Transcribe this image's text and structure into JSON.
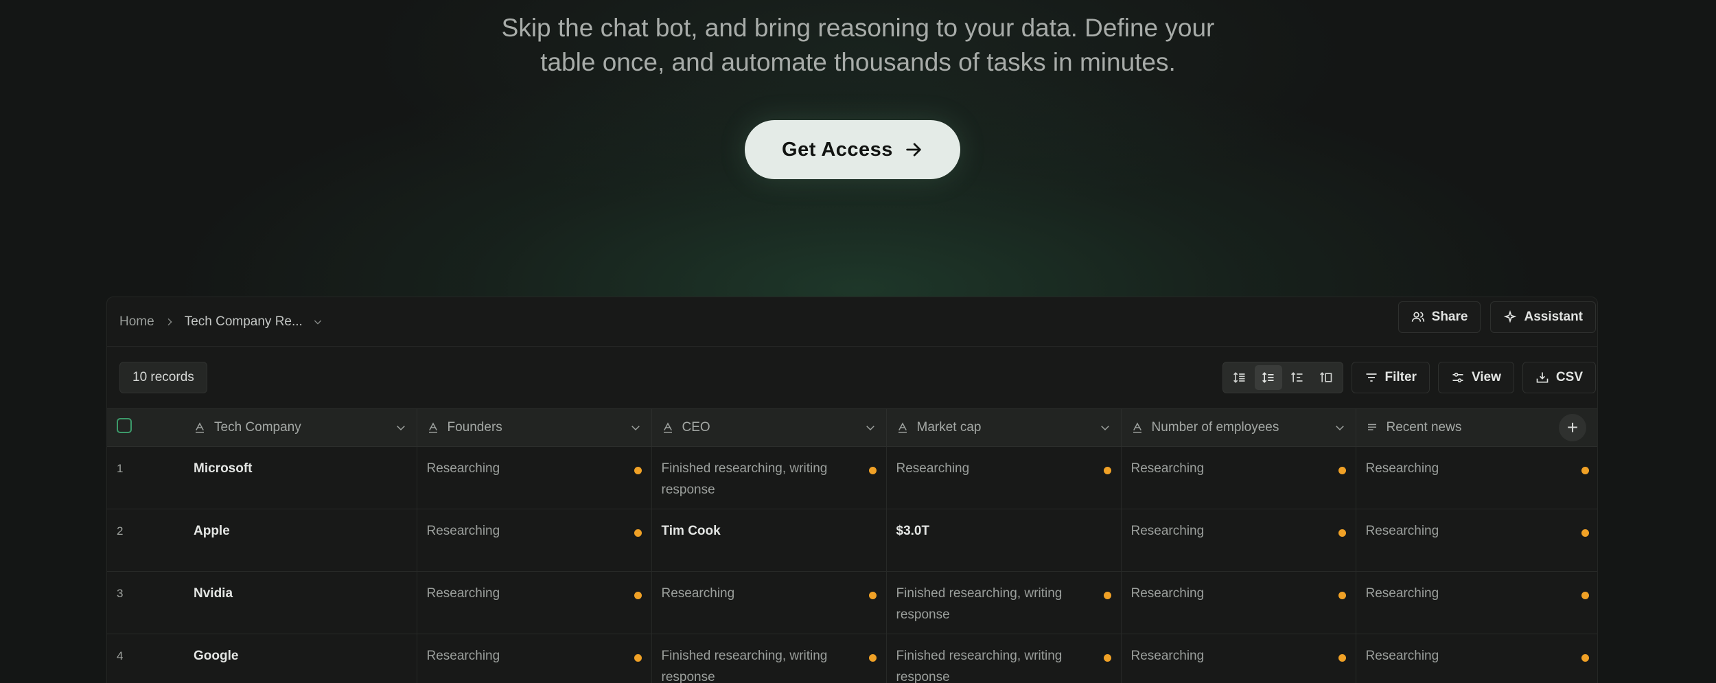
{
  "hero": {
    "line1": "Skip the chat bot, and bring reasoning to your data. Define your",
    "line2": "table once, and automate thousands of tasks in minutes.",
    "cta_label": "Get Access"
  },
  "breadcrumb": {
    "home": "Home",
    "current": "Tech Company Re..."
  },
  "top_actions": {
    "share": "Share",
    "assistant": "Assistant"
  },
  "toolbar": {
    "records": "10 records",
    "filter": "Filter",
    "view": "View",
    "csv": "CSV"
  },
  "columns": [
    "Tech Company",
    "Founders",
    "CEO",
    "Market cap",
    "Number of employees",
    "Recent news"
  ],
  "rows": [
    {
      "num": "1",
      "company": "Microsoft",
      "founders": "Researching",
      "ceo": "Finished researching, writing response",
      "market_cap": "Researching",
      "employees": "Researching",
      "news": "Researching"
    },
    {
      "num": "2",
      "company": "Apple",
      "founders": "Researching",
      "ceo": "Tim Cook",
      "market_cap": "$3.0T",
      "employees": "Researching",
      "news": "Researching"
    },
    {
      "num": "3",
      "company": "Nvidia",
      "founders": "Researching",
      "ceo": "Researching",
      "market_cap": "Finished researching, writing response",
      "employees": "Researching",
      "news": "Researching"
    },
    {
      "num": "4",
      "company": "Google",
      "founders": "Researching",
      "ceo": "Finished researching, writing response",
      "market_cap": "Finished researching, writing response",
      "employees": "Researching",
      "news": "Researching"
    }
  ],
  "colors": {
    "status_dot": "#f0a126",
    "accent_checkbox": "#3c9a6a",
    "cta_bg": "#e4ebe7"
  }
}
